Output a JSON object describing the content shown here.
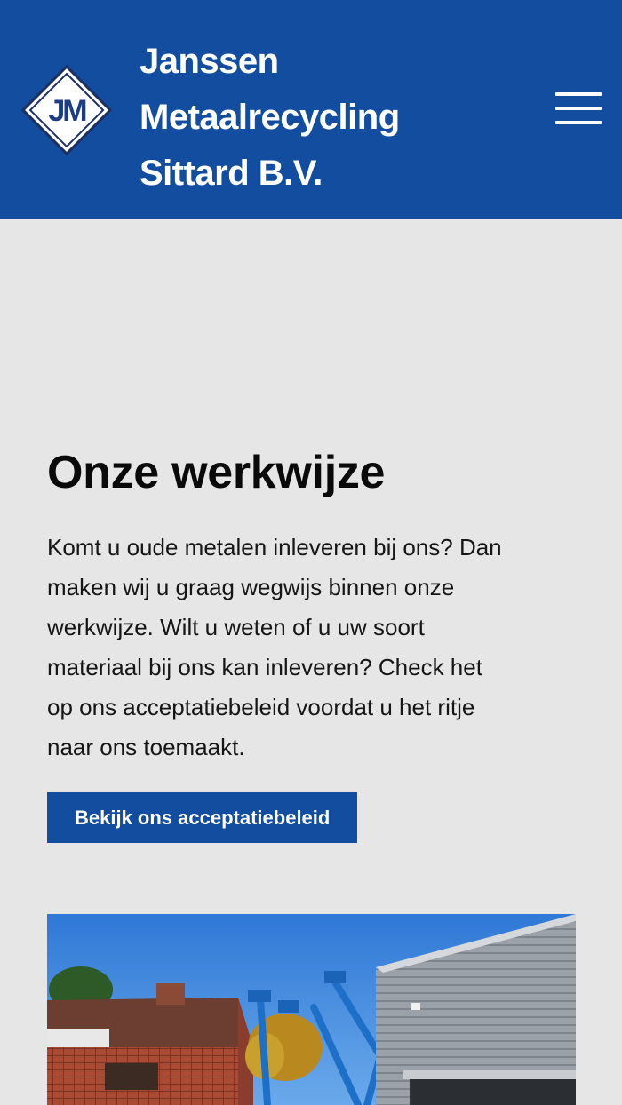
{
  "header": {
    "brand_lines": [
      "Janssen",
      "Metaalrecycling",
      "Sittard B.V."
    ],
    "logo_letters": "JM",
    "menu_icon": "hamburger-menu-icon",
    "color": "#124da0"
  },
  "main": {
    "title": "Onze werkwijze",
    "intro": "Komt u oude metalen inleveren bij ons? Dan maken wij u graag wegwijs binnen onze werkwijze. Wilt u weten of u uw soort materiaal bij ons kan inleveren? Check het op ons acceptatiebeleid voordat u het ritje naar ons toemaakt.",
    "cta_label": "Bekijk ons acceptatiebeleid"
  },
  "photo": {
    "subject": "company-yard-photo"
  }
}
